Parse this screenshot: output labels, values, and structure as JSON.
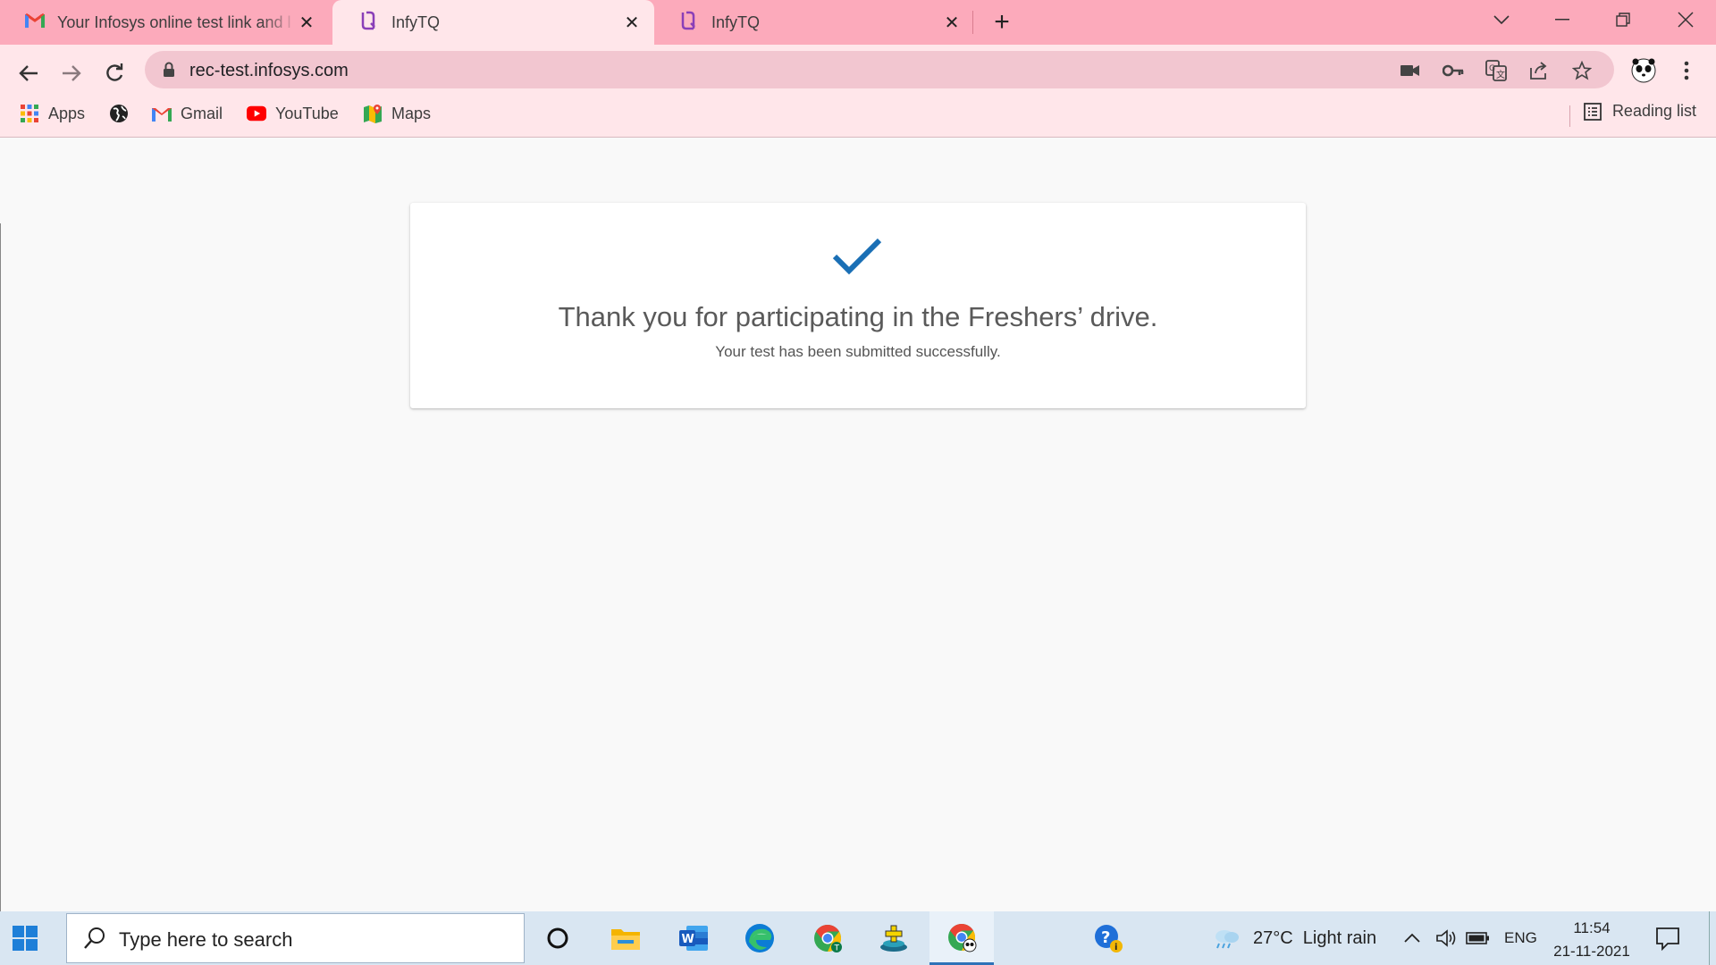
{
  "browser": {
    "tabs": [
      {
        "title": "Your Infosys online test link and l",
        "icon": "gmail-icon",
        "active": false
      },
      {
        "title": "InfyTQ",
        "icon": "infytq-icon",
        "active": true
      },
      {
        "title": "InfyTQ",
        "icon": "infytq-icon",
        "active": false
      }
    ],
    "url": "rec-test.infosys.com",
    "bookmarks": [
      {
        "label": "Apps",
        "icon": "apps-grid-icon"
      },
      {
        "label": "",
        "icon": "globe-icon"
      },
      {
        "label": "Gmail",
        "icon": "gmail-icon"
      },
      {
        "label": "YouTube",
        "icon": "youtube-icon"
      },
      {
        "label": "Maps",
        "icon": "maps-icon"
      }
    ],
    "reading_list": "Reading list",
    "colors": {
      "tabstrip": "#fcaabb",
      "toolbar": "#ffe6ea",
      "omnibox": "#f2c6d0"
    }
  },
  "page": {
    "title": "Thank you for participating in the Freshers’ drive.",
    "subtitle": "Your test has been submitted successfully.",
    "check_color": "#1a6fb5"
  },
  "taskbar": {
    "search_placeholder": "Type here to search",
    "weather": "27°C  Light rain",
    "language": "ENG",
    "time": "11:54",
    "date": "21-11-2021"
  }
}
